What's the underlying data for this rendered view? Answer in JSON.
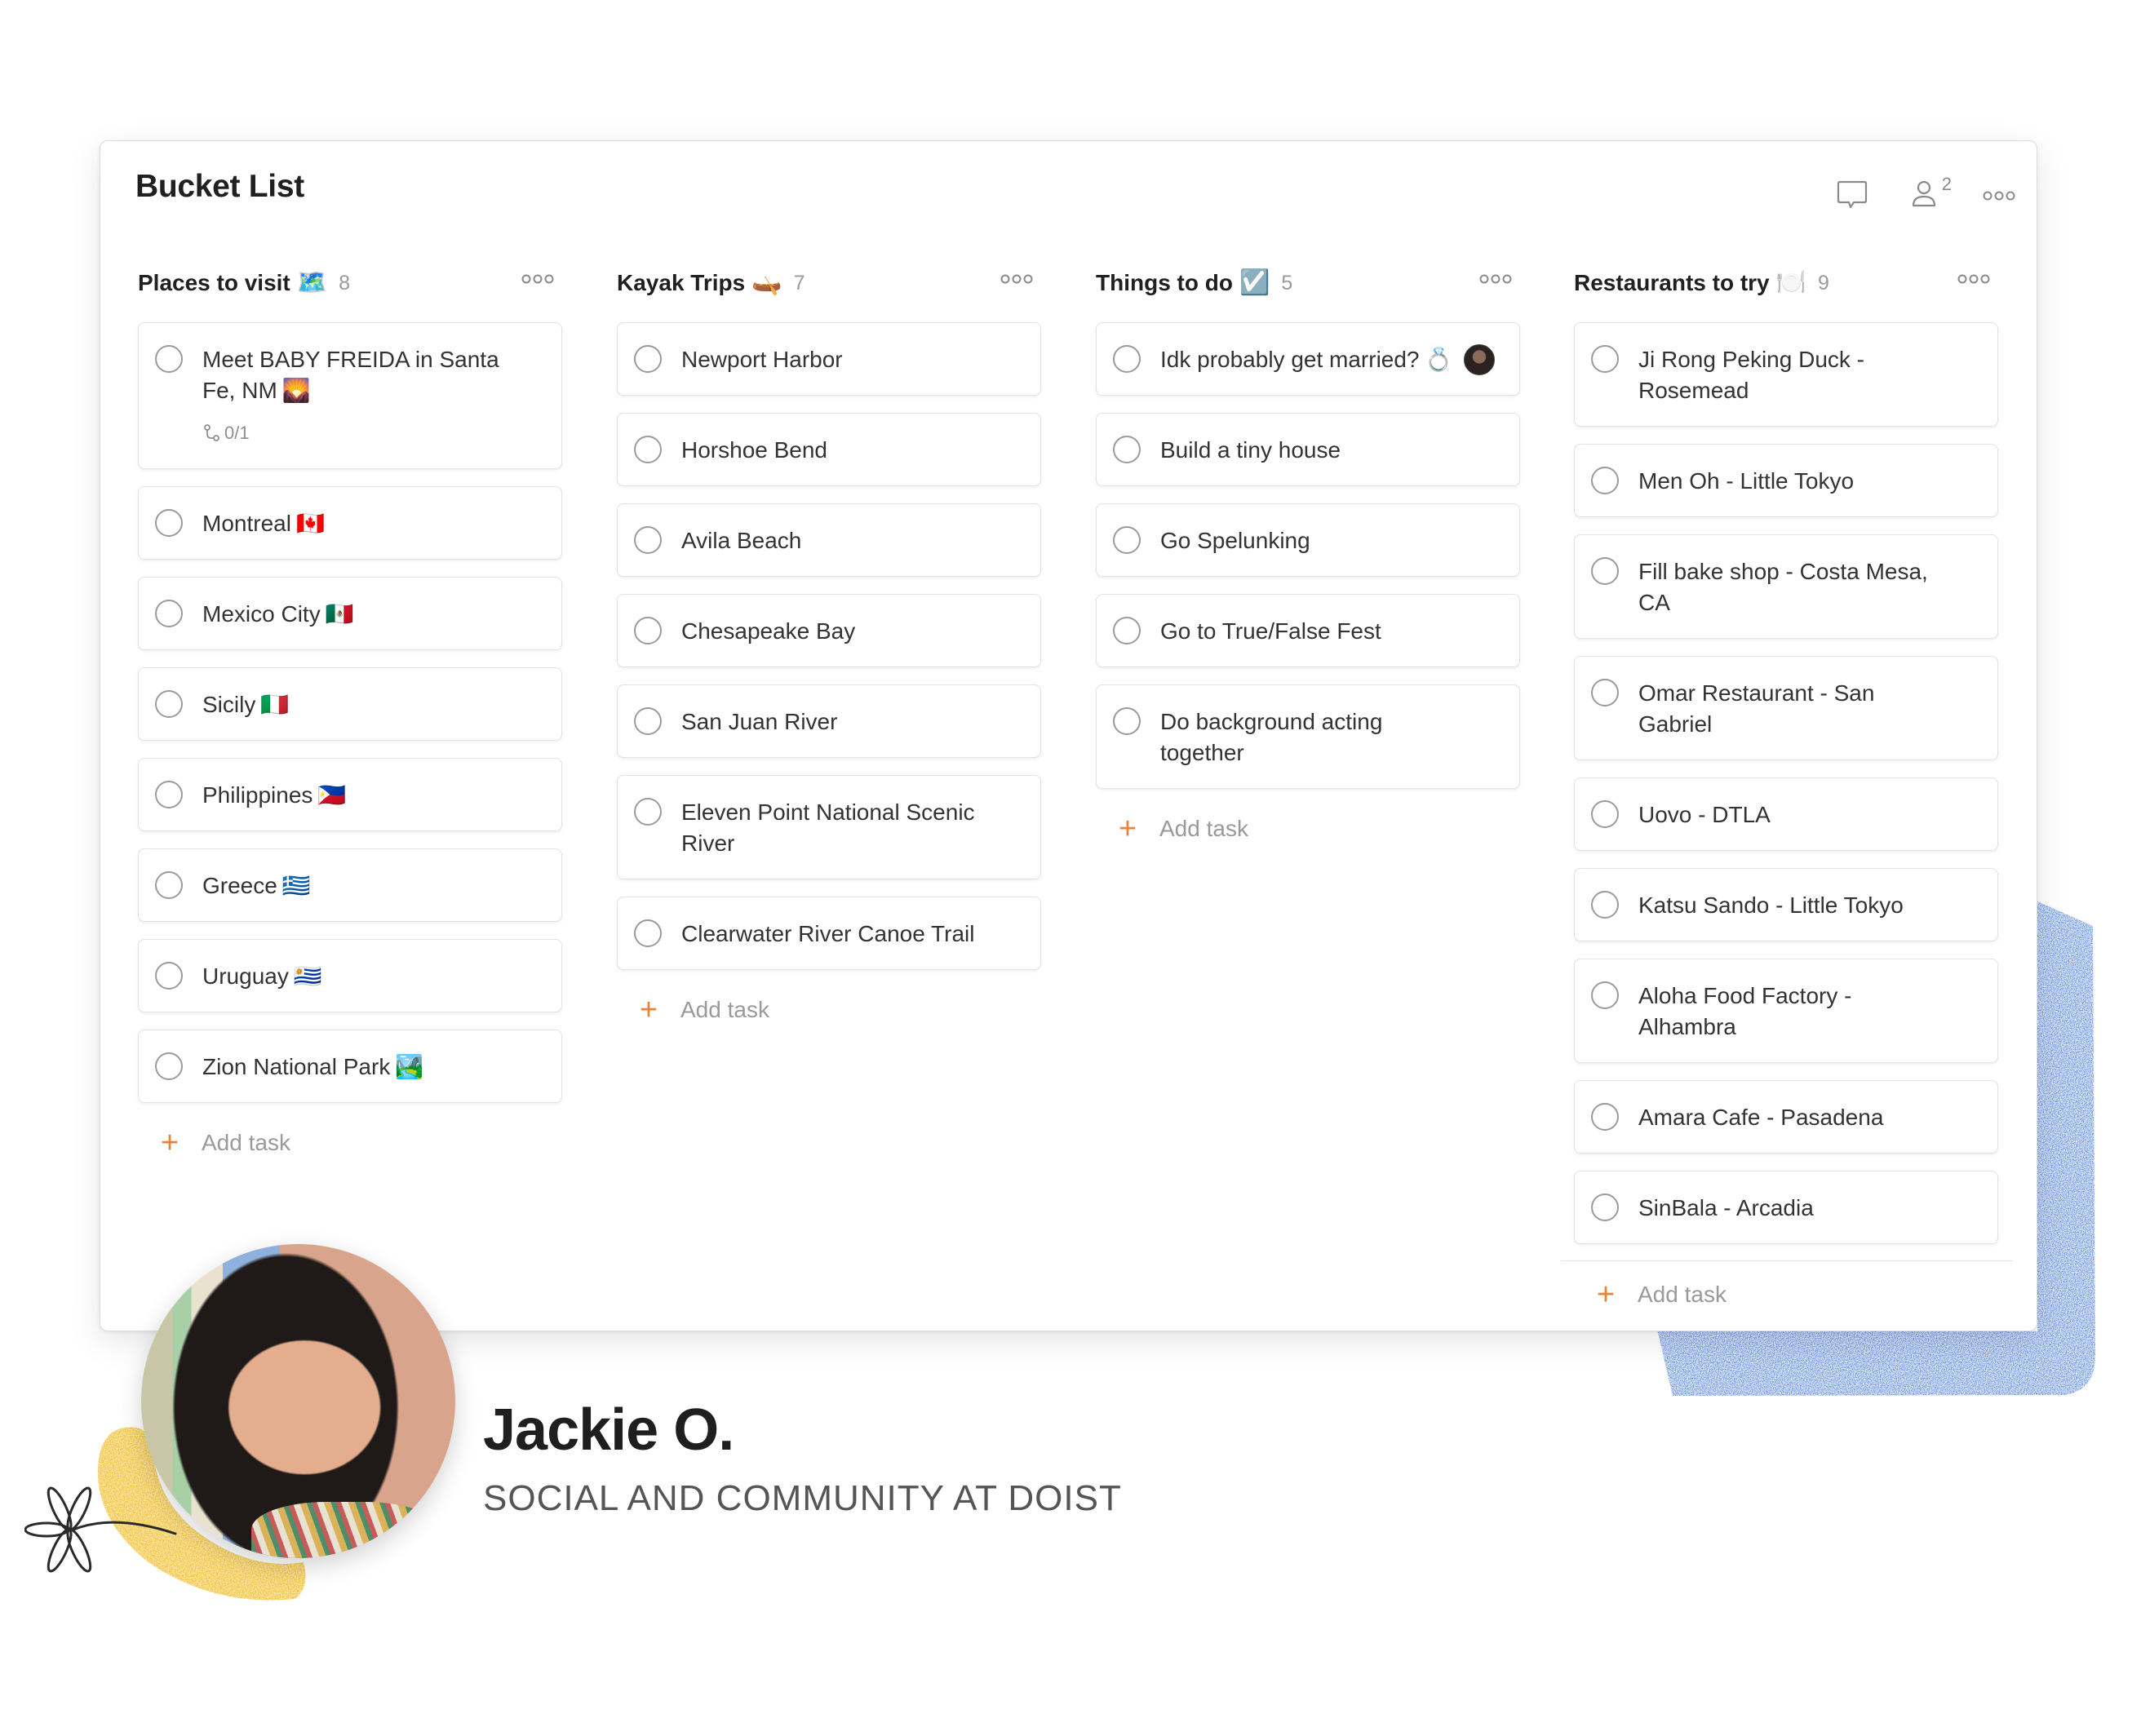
{
  "board": {
    "title": "Bucket List",
    "collaborator_count": "2",
    "header_icons": [
      "comment-icon",
      "collaborators-icon",
      "more-icon"
    ]
  },
  "add_task_label": "Add task",
  "columns": [
    {
      "title": "Places to visit",
      "emoji": "🗺️",
      "emoji_name": "world-map-icon",
      "count": "8",
      "tasks": [
        {
          "text": "Meet BABY FREIDA in Santa Fe, NM",
          "emoji": "🌄",
          "subtasks": "0/1"
        },
        {
          "text": "Montreal",
          "emoji": "🇨🇦"
        },
        {
          "text": "Mexico City",
          "emoji": "🇲🇽"
        },
        {
          "text": "Sicily",
          "emoji": "🇮🇹"
        },
        {
          "text": "Philippines",
          "emoji": "🇵🇭"
        },
        {
          "text": "Greece",
          "emoji": "🇬🇷"
        },
        {
          "text": "Uruguay",
          "emoji": "🇺🇾"
        },
        {
          "text": "Zion National Park",
          "emoji": "🏞️"
        }
      ]
    },
    {
      "title": "Kayak Trips",
      "emoji": "🛶",
      "emoji_name": "canoe-icon",
      "count": "7",
      "tasks": [
        {
          "text": "Newport Harbor"
        },
        {
          "text": "Horshoe Bend"
        },
        {
          "text": "Avila Beach"
        },
        {
          "text": "Chesapeake Bay"
        },
        {
          "text": "San Juan River"
        },
        {
          "text": "Eleven Point National Scenic River"
        },
        {
          "text": "Clearwater River Canoe Trail"
        }
      ]
    },
    {
      "title": "Things to do",
      "emoji": "☑️",
      "emoji_name": "check-box-icon",
      "count": "5",
      "tasks": [
        {
          "text": "Idk probably get married?",
          "emoji": "💍",
          "assignee": true
        },
        {
          "text": "Build a tiny house"
        },
        {
          "text": "Go Spelunking"
        },
        {
          "text": "Go to True/False Fest"
        },
        {
          "text": "Do background acting together"
        }
      ]
    },
    {
      "title": "Restaurants to try",
      "emoji": "🍽️",
      "emoji_name": "fork-knife-plate-icon",
      "count": "9",
      "tasks": [
        {
          "text": "Ji Rong Peking Duck - Rosemead"
        },
        {
          "text": "Men Oh - Little Tokyo"
        },
        {
          "text": "Fill bake shop - Costa Mesa, CA"
        },
        {
          "text": "Omar Restaurant - San Gabriel"
        },
        {
          "text": "Uovo - DTLA"
        },
        {
          "text": "Katsu Sando - Little Tokyo"
        },
        {
          "text": "Aloha Food Factory - Alhambra"
        },
        {
          "text": "Amara Cafe - Pasadena"
        },
        {
          "text": "SinBala - Arcadia"
        }
      ]
    }
  ],
  "profile": {
    "name": "Jackie O.",
    "title": "SOCIAL AND COMMUNITY AT DOIST"
  },
  "colors": {
    "accent": "#e8843a",
    "scribble": "#3f74df",
    "highlight": "#f2c43d",
    "text": "#333333",
    "muted": "#9a9a9a"
  }
}
